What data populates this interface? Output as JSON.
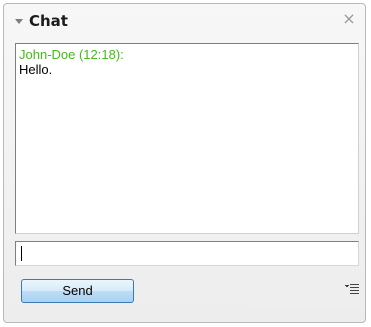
{
  "header": {
    "title": "Chat",
    "collapse_icon": "triangle-down-icon",
    "close_label": "×"
  },
  "messages": [
    {
      "author": "John-Doe (12:18):",
      "text": "Hello."
    }
  ],
  "input": {
    "value": "",
    "placeholder": ""
  },
  "send_label": "Send",
  "options_icon": "list-options-icon",
  "colors": {
    "author": "#47b81d",
    "button_border": "#3c78b3",
    "panel_border": "#b9b9b9"
  }
}
